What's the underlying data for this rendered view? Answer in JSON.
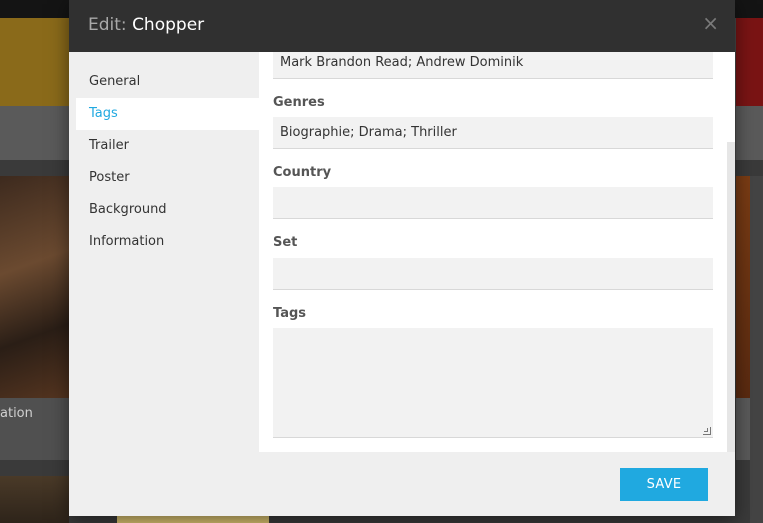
{
  "background": {
    "partial_label": "ation"
  },
  "modal": {
    "title_prefix": "Edit:",
    "title": "Chopper",
    "close_label": "×",
    "sidebar": {
      "items": [
        {
          "label": "General",
          "active": false
        },
        {
          "label": "Tags",
          "active": true
        },
        {
          "label": "Trailer",
          "active": false
        },
        {
          "label": "Poster",
          "active": false
        },
        {
          "label": "Background",
          "active": false
        },
        {
          "label": "Information",
          "active": false
        }
      ]
    },
    "fields": {
      "directors_value": "Mark Brandon Read; Andrew Dominik",
      "genres_label": "Genres",
      "genres_value": "Biographie; Drama; Thriller",
      "country_label": "Country",
      "country_value": "",
      "set_label": "Set",
      "set_value": "",
      "tags_label": "Tags",
      "tags_value": ""
    },
    "save_label": "SAVE"
  },
  "colors": {
    "accent": "#20a9e0",
    "header_bg": "#303030",
    "sidebar_bg": "#efefef"
  }
}
